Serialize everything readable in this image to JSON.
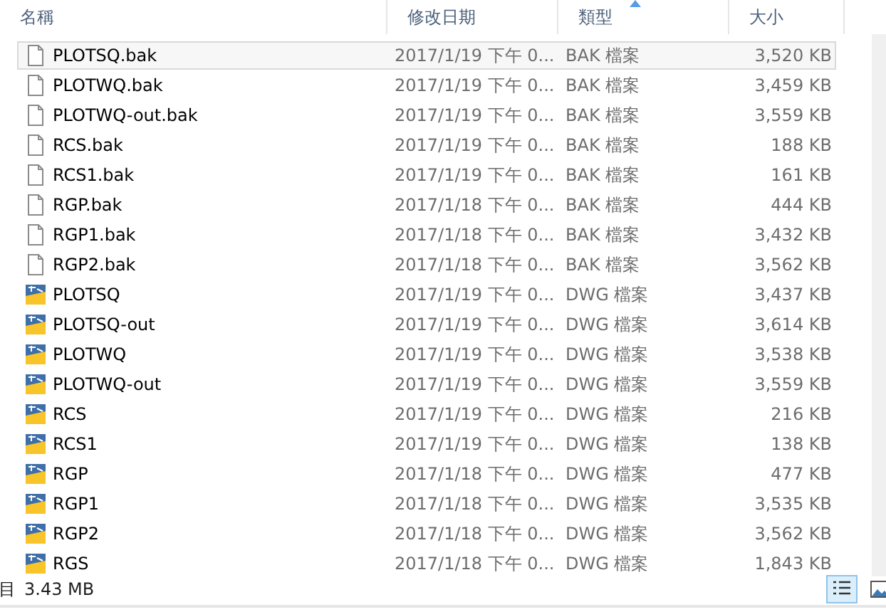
{
  "columns": [
    {
      "label": "名稱",
      "sorted": false
    },
    {
      "label": "修改日期",
      "sorted": false
    },
    {
      "label": "類型",
      "sorted": true
    },
    {
      "label": "大小",
      "sorted": false
    }
  ],
  "rows": [
    {
      "name": "PLOTSQ.bak",
      "date": "2017/1/19 下午 0...",
      "type": "BAK 檔案",
      "size": "3,520 KB",
      "kind": "bak",
      "selected": true
    },
    {
      "name": "PLOTWQ.bak",
      "date": "2017/1/19 下午 0...",
      "type": "BAK 檔案",
      "size": "3,459 KB",
      "kind": "bak",
      "selected": false
    },
    {
      "name": "PLOTWQ-out.bak",
      "date": "2017/1/19 下午 0...",
      "type": "BAK 檔案",
      "size": "3,559 KB",
      "kind": "bak",
      "selected": false
    },
    {
      "name": "RCS.bak",
      "date": "2017/1/19 下午 0...",
      "type": "BAK 檔案",
      "size": "188 KB",
      "kind": "bak",
      "selected": false
    },
    {
      "name": "RCS1.bak",
      "date": "2017/1/19 下午 0...",
      "type": "BAK 檔案",
      "size": "161 KB",
      "kind": "bak",
      "selected": false
    },
    {
      "name": "RGP.bak",
      "date": "2017/1/18 下午 0...",
      "type": "BAK 檔案",
      "size": "444 KB",
      "kind": "bak",
      "selected": false
    },
    {
      "name": "RGP1.bak",
      "date": "2017/1/18 下午 0...",
      "type": "BAK 檔案",
      "size": "3,432 KB",
      "kind": "bak",
      "selected": false
    },
    {
      "name": "RGP2.bak",
      "date": "2017/1/18 下午 0...",
      "type": "BAK 檔案",
      "size": "3,562 KB",
      "kind": "bak",
      "selected": false
    },
    {
      "name": "PLOTSQ",
      "date": "2017/1/19 下午 0...",
      "type": "DWG 檔案",
      "size": "3,437 KB",
      "kind": "dwg",
      "selected": false
    },
    {
      "name": "PLOTSQ-out",
      "date": "2017/1/19 下午 0...",
      "type": "DWG 檔案",
      "size": "3,614 KB",
      "kind": "dwg",
      "selected": false
    },
    {
      "name": "PLOTWQ",
      "date": "2017/1/19 下午 0...",
      "type": "DWG 檔案",
      "size": "3,538 KB",
      "kind": "dwg",
      "selected": false
    },
    {
      "name": "PLOTWQ-out",
      "date": "2017/1/19 下午 0...",
      "type": "DWG 檔案",
      "size": "3,559 KB",
      "kind": "dwg",
      "selected": false
    },
    {
      "name": "RCS",
      "date": "2017/1/19 下午 0...",
      "type": "DWG 檔案",
      "size": "216 KB",
      "kind": "dwg",
      "selected": false
    },
    {
      "name": "RCS1",
      "date": "2017/1/19 下午 0...",
      "type": "DWG 檔案",
      "size": "138 KB",
      "kind": "dwg",
      "selected": false
    },
    {
      "name": "RGP",
      "date": "2017/1/18 下午 0...",
      "type": "DWG 檔案",
      "size": "477 KB",
      "kind": "dwg",
      "selected": false
    },
    {
      "name": "RGP1",
      "date": "2017/1/18 下午 0...",
      "type": "DWG 檔案",
      "size": "3,535 KB",
      "kind": "dwg",
      "selected": false
    },
    {
      "name": "RGP2",
      "date": "2017/1/18 下午 0...",
      "type": "DWG 檔案",
      "size": "3,562 KB",
      "kind": "dwg",
      "selected": false
    },
    {
      "name": "RGS",
      "date": "2017/1/18 下午 0...",
      "type": "DWG 檔案",
      "size": "1,843 KB",
      "kind": "dwg",
      "selected": false
    }
  ],
  "status_bar": {
    "items_label": "目",
    "size": "3.43 MB"
  }
}
